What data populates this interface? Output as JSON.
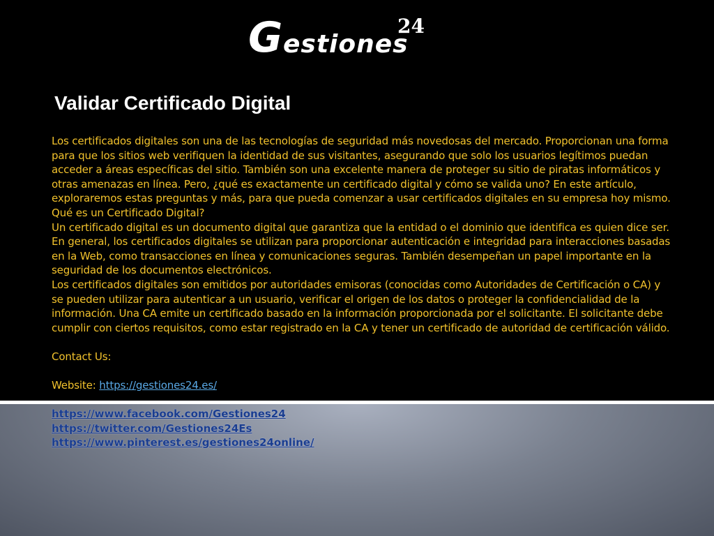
{
  "logo": {
    "letter": "G",
    "rest": "estiones",
    "number": "24"
  },
  "title": "Validar Certificado Digital",
  "paragraphs": [
    "Los certificados digitales son una de las tecnologías de seguridad más novedosas del mercado. Proporcionan una forma para que los sitios web verifiquen la identidad de sus visitantes, asegurando que solo los usuarios legítimos puedan acceder a áreas específicas del sitio. También son una excelente manera de proteger su sitio de piratas informáticos y otras amenazas en línea. Pero, ¿qué es exactamente un certificado digital y cómo se valida uno? En este artículo, exploraremos estas preguntas y más, para que pueda comenzar a usar certificados digitales en su empresa hoy mismo.",
    "Qué es un Certificado Digital?",
    "Un certificado digital es un documento digital que garantiza que la entidad o el dominio que identifica es quien dice ser. En general, los certificados digitales se utilizan para proporcionar autenticación e integridad para interacciones basadas en la Web, como transacciones en línea y comunicaciones seguras. También desempeñan un papel importante en la seguridad de los documentos electrónicos.",
    "Los certificados digitales son emitidos por autoridades emisoras (conocidas como Autoridades de Certificación o CA) y se pueden utilizar para autenticar a un usuario, verificar el origen de los datos o proteger la confidencialidad de la información. Una CA emite un certificado basado en la información proporcionada por el solicitante. El solicitante debe cumplir con ciertos requisitos, como estar registrado en la CA y tener un certificado de autoridad de certificación válido."
  ],
  "contact_label": "Contact Us:",
  "website_label": "Website: ",
  "website_url": "https://gestiones24.es/",
  "social_links": [
    "https://www.facebook.com/Gestiones24",
    "https://twitter.com/Gestiones24Es",
    "https://www.pinterest.es/gestiones24online/"
  ],
  "colors": {
    "background_top": "#000000",
    "body_text": "#f2c22c",
    "title_text": "#ffffff",
    "website_link": "#5aa9e6",
    "social_link": "#1a3d8f",
    "divider": "#ffffff"
  }
}
